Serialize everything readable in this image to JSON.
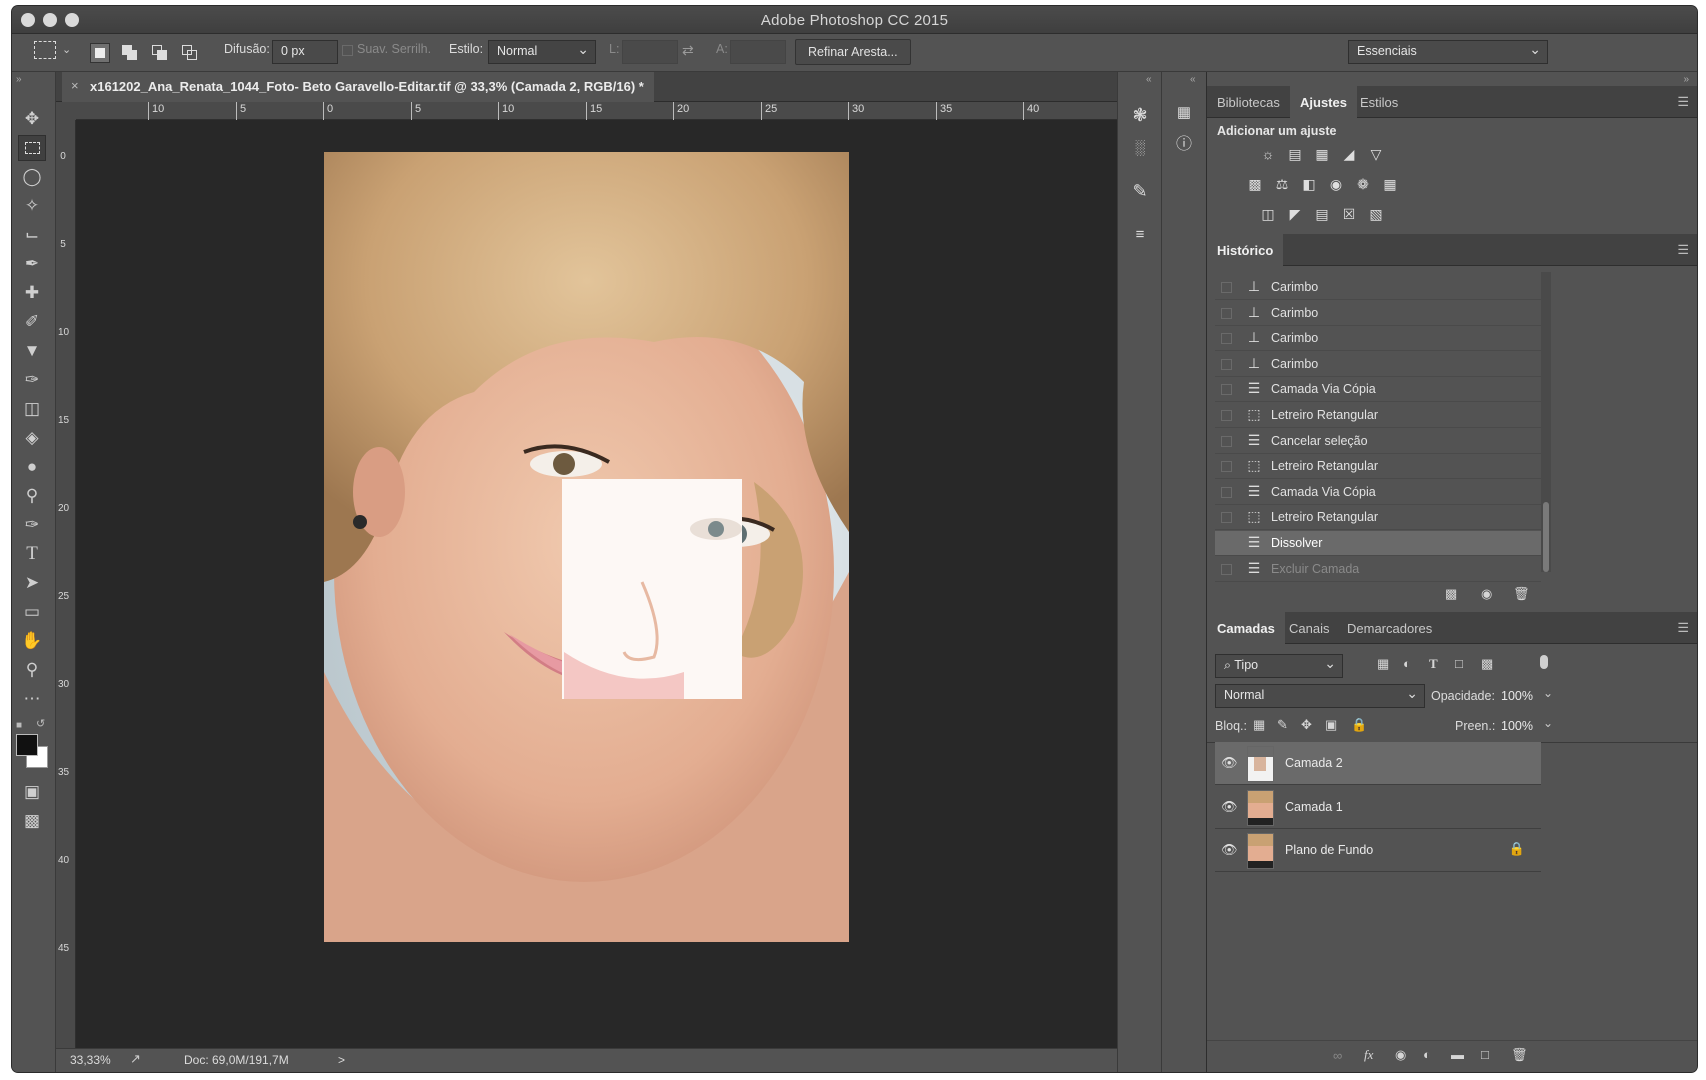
{
  "window": {
    "title": "Adobe Photoshop CC 2015"
  },
  "options": {
    "feather_label": "Difusão:",
    "feather_value": "0 px",
    "antialias_label": "Suav. Serrilh.",
    "style_label": "Estilo:",
    "style_value": "Normal",
    "width_label": "L:",
    "height_label": "A:",
    "refine_edge_button": "Refinar Aresta...",
    "workspace_value": "Essenciais"
  },
  "document": {
    "tab_title": "x161202_Ana_Renata_1044_Foto- Beto Garavello-Editar.tif @ 33,3% (Camada 2, RGB/16) *",
    "ruler_top": [
      "10",
      "5",
      "0",
      "5",
      "10",
      "15",
      "20",
      "25",
      "30",
      "35",
      "40"
    ],
    "ruler_left": [
      "0",
      "5",
      "10",
      "15",
      "20",
      "25",
      "30",
      "35",
      "40",
      "45"
    ]
  },
  "status": {
    "zoom": "33,33%",
    "doc_size": "Doc: 69,0M/191,7M",
    "arrow": ">"
  },
  "panels": {
    "top_tabs": [
      "Bibliotecas",
      "Ajustes",
      "Estilos"
    ],
    "adjust_title": "Adicionar um ajuste",
    "history_tab": "Histórico",
    "history": [
      {
        "label": "Carimbo",
        "icon": "stamp"
      },
      {
        "label": "Carimbo",
        "icon": "stamp"
      },
      {
        "label": "Carimbo",
        "icon": "stamp"
      },
      {
        "label": "Carimbo",
        "icon": "stamp"
      },
      {
        "label": "Camada Via Cópia",
        "icon": "document"
      },
      {
        "label": "Letreiro Retangular",
        "icon": "marquee"
      },
      {
        "label": "Cancelar seleção",
        "icon": "document"
      },
      {
        "label": "Letreiro Retangular",
        "icon": "marquee"
      },
      {
        "label": "Camada Via Cópia",
        "icon": "document"
      },
      {
        "label": "Letreiro Retangular",
        "icon": "marquee"
      },
      {
        "label": "Dissolver",
        "icon": "document",
        "selected": true
      },
      {
        "label": "Excluir Camada",
        "icon": "document",
        "dimmed": true
      }
    ],
    "layers_tabs": [
      "Camadas",
      "Canais",
      "Demarcadores"
    ],
    "filter_kind": "⌕ Tipo",
    "blend_mode": "Normal",
    "opacity_label": "Opacidade:",
    "opacity_value": "100%",
    "lock_label": "Bloq.:",
    "fill_label": "Preen.:",
    "fill_value": "100%",
    "layers": [
      {
        "name": "Camada 2",
        "selected": true
      },
      {
        "name": "Camada 1"
      },
      {
        "name": "Plano de Fundo",
        "locked": true
      }
    ]
  },
  "colors": {
    "ui_bg": "#535353",
    "panel_dark": "#424242",
    "canvas_bg": "#282828",
    "selected_row": "#6a6a6a"
  }
}
